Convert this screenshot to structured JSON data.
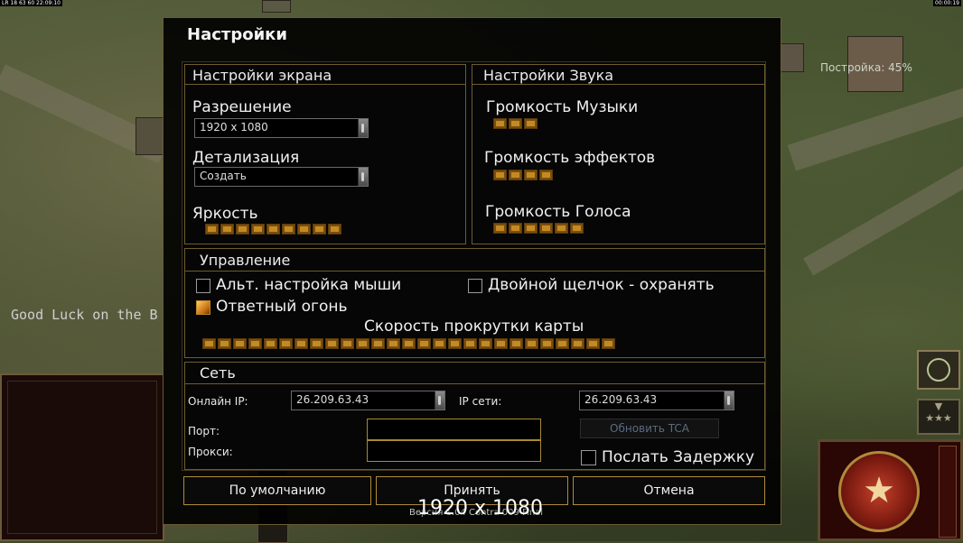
{
  "hud": {
    "top_left": "LR 18 63 60 22:09:10",
    "top_right": "00:00:19",
    "good_luck": "Good Luck on the B",
    "build_status": "Постройка: 45%"
  },
  "dialog": {
    "title": "Настройки",
    "screen": {
      "title": "Настройки экрана",
      "resolution_label": "Разрешение",
      "resolution_value": "1920 x 1080",
      "detail_label": "Детализация",
      "detail_value": "Создать",
      "brightness_label": "Яркость",
      "brightness_segments": 9
    },
    "sound": {
      "title": "Настройки Звука",
      "music_label": "Громкость Музыки",
      "music_segments": 3,
      "effects_label": "Громкость эффектов",
      "effects_segments": 4,
      "voice_label": "Громкость Голоса",
      "voice_segments": 6
    },
    "controls": {
      "title": "Управление",
      "alt_mouse_label": "Альт. настройка мыши",
      "alt_mouse_checked": false,
      "double_click_label": "Двойной щелчок - охранять",
      "double_click_checked": false,
      "return_fire_label": "Ответный огонь",
      "return_fire_checked": true,
      "scroll_speed_label": "Скорость прокрутки карты",
      "scroll_segments": 27
    },
    "network": {
      "title": "Сеть",
      "online_ip_label": "Онлайн IP:",
      "online_ip_value": "26.209.63.43",
      "lan_ip_label": "IP сети:",
      "lan_ip_value": "26.209.63.43",
      "port_label": "Порт:",
      "port_value": "",
      "proxy_label": "Прокси:",
      "proxy_value": "",
      "update_tca_label": "Обновить TCA",
      "send_delay_label": "Послать Задержку",
      "send_delay_checked": false
    },
    "buttons": {
      "default": "По умолчанию",
      "accept": "Принять",
      "cancel": "Отмена"
    },
    "footer_small": "Версия 1.04 Contra 009 Final",
    "resolution_overlay": "1920 x 1080"
  }
}
